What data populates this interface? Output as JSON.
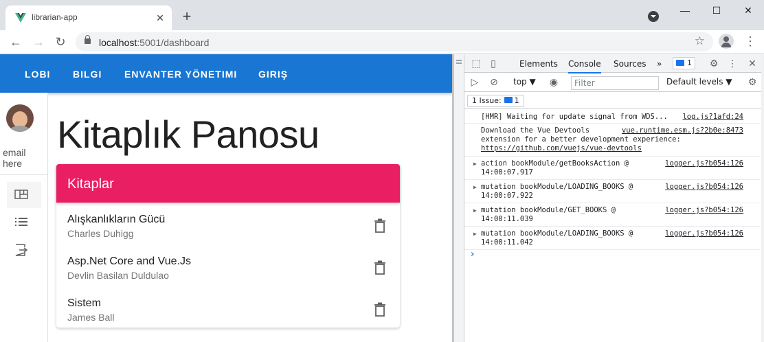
{
  "browser": {
    "tab_title": "librarian-app",
    "new_tab_label": "+",
    "tab_close": "✕",
    "url_host": "localhost",
    "url_rest": ":5001/dashboard",
    "window_controls": {
      "minimize": "—",
      "maximize": "☐",
      "close": "✕"
    }
  },
  "app": {
    "nav": [
      "LOBI",
      "BILGI",
      "ENVANTER YÖNETIMI",
      "GIRIŞ"
    ],
    "sidebar": {
      "email": "email here"
    },
    "heading": "Kitaplık Panosu",
    "card_title": "Kitaplar",
    "books": [
      {
        "title": "Alışkanlıkların Gücü",
        "author": "Charles Duhigg"
      },
      {
        "title": "Asp.Net Core and Vue.Js",
        "author": "Devlin Basilan Duldulao"
      },
      {
        "title": "Sistem",
        "author": "James Ball"
      }
    ],
    "colors": {
      "appbar": "#1976d2",
      "card_header": "#e91e63"
    }
  },
  "devtools": {
    "tabs": [
      "Elements",
      "Console",
      "Sources"
    ],
    "active_tab": "Console",
    "more": "»",
    "badge_count": "1",
    "context": "top ▼",
    "filter_placeholder": "Filter",
    "levels": "Default levels ▼",
    "issues_label": "1 Issue:",
    "issues_count": "1",
    "logs": [
      {
        "lines": [
          "[HMR] Waiting for update signal from WDS..."
        ],
        "source": "log.js?1afd:24"
      },
      {
        "lines": [
          "Download the Vue Devtools",
          "extension for a better development experience:",
          "https://github.com/vuejs/vue-devtools"
        ],
        "source": "vue.runtime.esm.js?2b0e:8473"
      },
      {
        "lines": [
          "action bookModule/getBooksAction @",
          "14:00:07.917"
        ],
        "source": "logger.js?b054:126"
      },
      {
        "lines": [
          "mutation bookModule/LOADING_BOOKS @",
          "14:00:07.922"
        ],
        "source": "logger.js?b054:126"
      },
      {
        "lines": [
          "mutation bookModule/GET_BOOKS @",
          "14:00:11.039"
        ],
        "source": "logger.js?b054:126"
      },
      {
        "lines": [
          "mutation bookModule/LOADING_BOOKS @",
          "14:00:11.042"
        ],
        "source": "logger.js?b054:126"
      }
    ],
    "prompt": "›"
  }
}
